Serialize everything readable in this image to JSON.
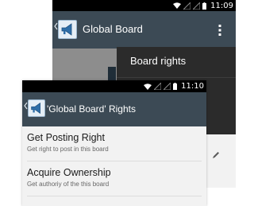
{
  "back_screen": {
    "status_bar": {
      "time": "11:09"
    },
    "app_bar": {
      "title": "Global Board"
    },
    "overflow_menu": {
      "items": [
        {
          "label": "Board rights"
        }
      ]
    }
  },
  "front_screen": {
    "status_bar": {
      "time": "11:10"
    },
    "app_bar": {
      "title": "'Global Board' Rights"
    },
    "items": [
      {
        "title": "Get Posting Right",
        "subtitle": "Get right to post in this board"
      },
      {
        "title": "Acquire Ownership",
        "subtitle": "Get authoriy of the this board"
      }
    ]
  },
  "colors": {
    "app_bar": "#3c4a55",
    "status_bar": "#000000",
    "menu_background": "#2b2b2b",
    "list_background": "#f2f2f2"
  },
  "icons": [
    "wifi-icon",
    "signal-icon",
    "battery-icon",
    "up-chevron-icon",
    "megaphone-icon",
    "overflow-kebab-icon",
    "pencil-icon"
  ]
}
